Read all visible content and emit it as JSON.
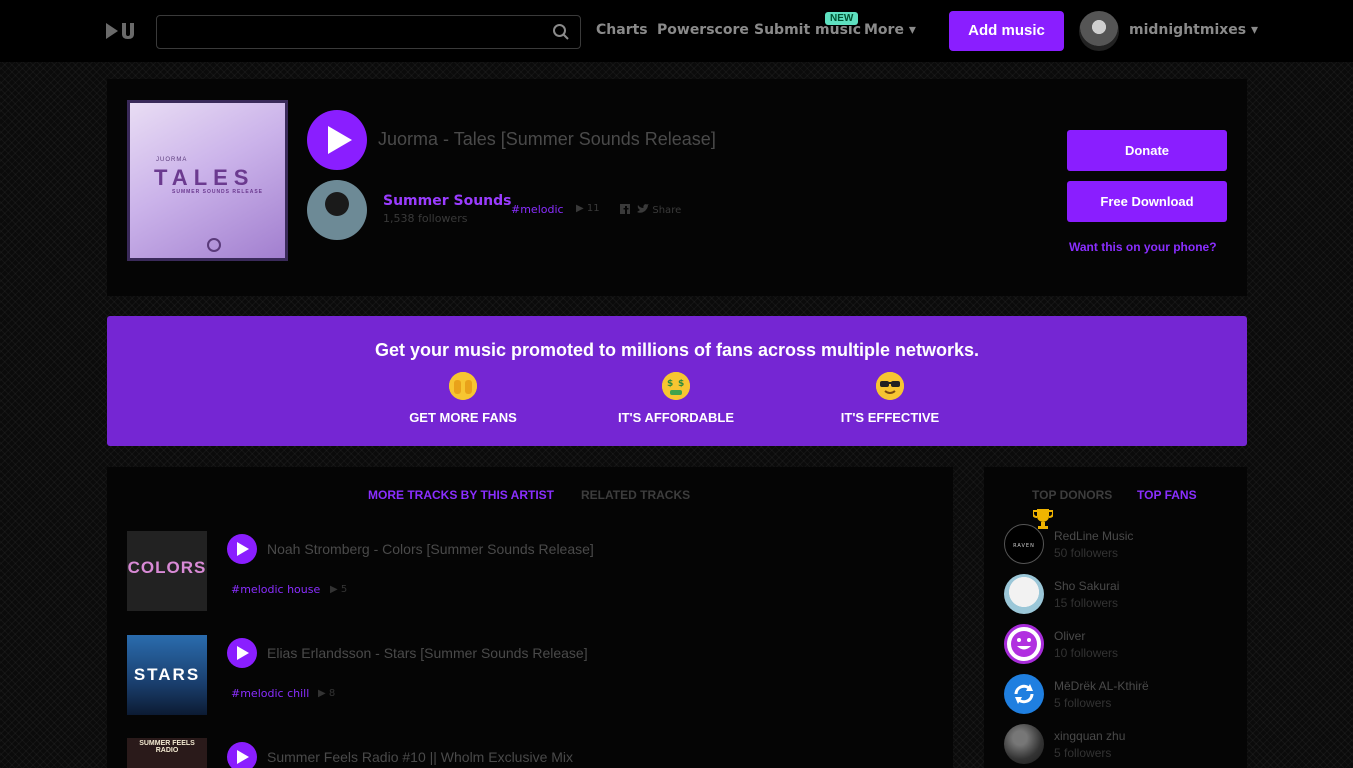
{
  "header": {
    "search_placeholder": "",
    "nav": {
      "charts": "Charts",
      "powerscore": "Powerscore",
      "submit": "Submit music",
      "more": "More ▾"
    },
    "new_badge": "NEW",
    "add_music": "Add music",
    "username": "midnightmixes ▾"
  },
  "track": {
    "cover_artist": "JUORMA",
    "cover_title": "TALES",
    "cover_subtitle": "SUMMER SOUNDS RELEASE",
    "title": "Juorma - Tales [Summer Sounds Release]",
    "artist": "Summer Sounds",
    "followers": "1,538 followers",
    "tag": "#melodic",
    "plays": "▶ 11",
    "share": "Share",
    "donate": "Donate",
    "download": "Free Download",
    "phone": "Want this on your phone?"
  },
  "promo": {
    "title": "Get your music promoted to millions of fans across multiple networks.",
    "features": [
      {
        "label": "GET MORE FANS",
        "icon": "raised-hands-emoji"
      },
      {
        "label": "IT'S AFFORDABLE",
        "icon": "money-mouth-emoji"
      },
      {
        "label": "IT'S EFFECTIVE",
        "icon": "sunglasses-emoji"
      }
    ]
  },
  "tracks": {
    "tab_more": "MORE TRACKS BY THIS ARTIST",
    "tab_related": "RELATED TRACKS",
    "items": [
      {
        "title": "Noah Stromberg - Colors [Summer Sounds Release]",
        "tag": "#melodic house",
        "plays": "▶ 5",
        "thumb_text": "COLORS"
      },
      {
        "title": "Elias Erlandsson - Stars [Summer Sounds Release]",
        "tag": "#melodic chill",
        "plays": "▶ 8",
        "thumb_text": "STARS"
      },
      {
        "title": "Summer Feels Radio #10 || Wholm Exclusive Mix",
        "tag": "",
        "plays": "",
        "thumb_text": "SUMMER FEELS RADIO"
      }
    ]
  },
  "fans": {
    "tab_donors": "TOP DONORS",
    "tab_fans": "TOP FANS",
    "items": [
      {
        "name": "RedLine Music",
        "followers": "50 followers"
      },
      {
        "name": "Sho Sakurai",
        "followers": "15 followers"
      },
      {
        "name": "Oliver",
        "followers": "10 followers"
      },
      {
        "name": "MēDrëk AL-Kthirë",
        "followers": "5 followers"
      },
      {
        "name": "xingquan zhu",
        "followers": "5 followers"
      }
    ]
  },
  "colors": {
    "accent": "#8a1eff",
    "promo_bg": "#7526d3",
    "badge": "#5ee0c0"
  }
}
